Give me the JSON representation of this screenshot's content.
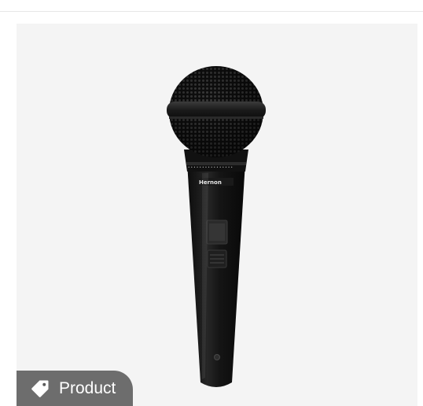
{
  "badge": {
    "label": "Product",
    "icon": "tag-icon"
  },
  "product_image": {
    "brand_label": "Hernon",
    "colors": {
      "background": "#f4f4f4",
      "body": "#151515",
      "badge": "#464646"
    }
  }
}
